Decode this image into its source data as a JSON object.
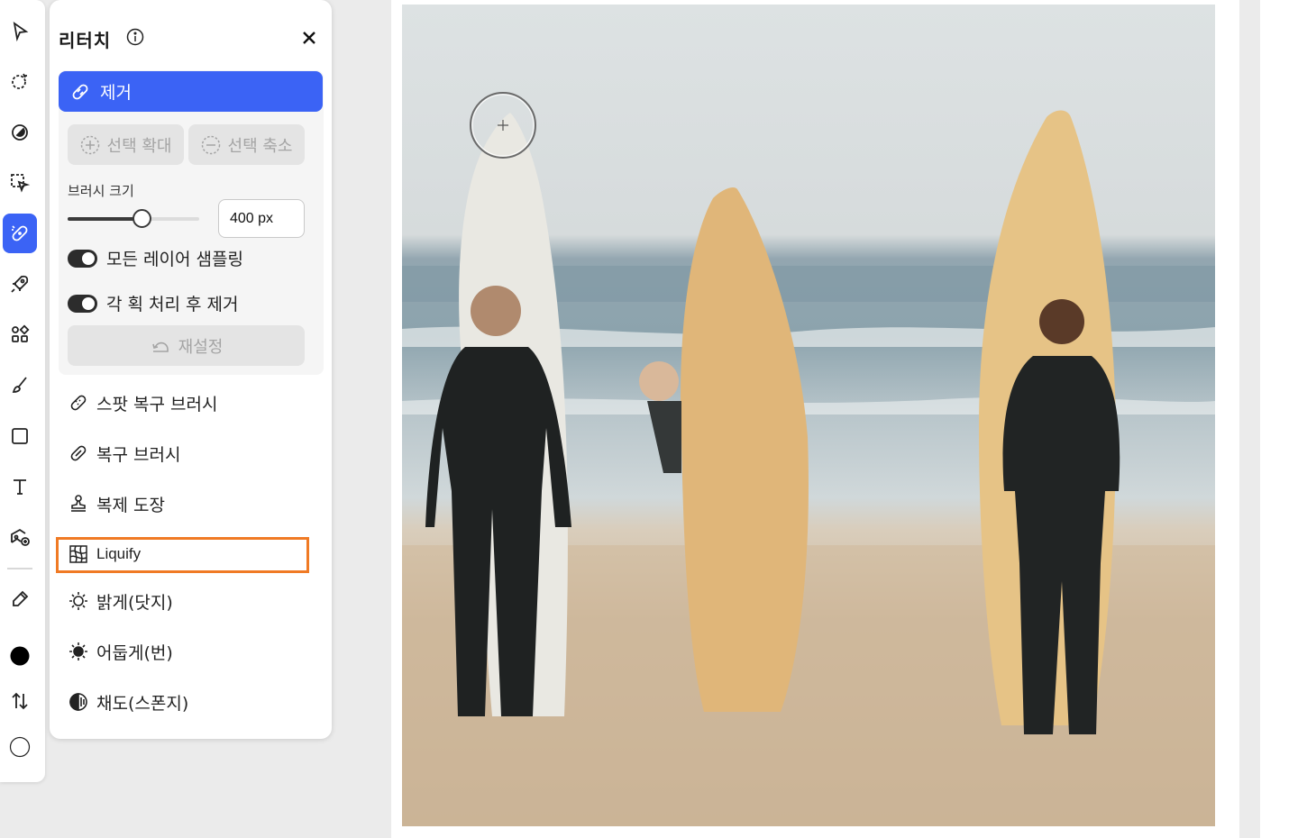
{
  "toolbar": {
    "tools": [
      "select-tool",
      "magic-select-tool",
      "adjust-tool",
      "cutout-tool",
      "retouch-tool",
      "quick-actions-tool",
      "layout-tool",
      "brush-tool",
      "shape-tool",
      "text-tool",
      "add-image-tool",
      "eyedropper-tool"
    ],
    "active_tool": "retouch-tool",
    "foreground_color": "#000000",
    "background_color": "#ffffff"
  },
  "panel": {
    "title": "리터치",
    "remove_label": "제거",
    "expand_selection_label": "선택 확대",
    "shrink_selection_label": "선택 축소",
    "brush_size_label": "브러시 크기",
    "brush_size_value": "400 px",
    "brush_size_fraction": 0.56,
    "sample_all_layers_label": "모든 레이어 샘플링",
    "sample_all_layers_on": true,
    "remove_after_stroke_label": "각 획 처리 후 제거",
    "remove_after_stroke_on": true,
    "reset_label": "재설정",
    "tools": {
      "spot_healing": "스팟 복구 브러시",
      "healing": "복구 브러시",
      "clone_stamp": "복제 도장",
      "liquify": "Liquify",
      "dodge": "밝게(닷지)",
      "burn": "어둡게(번)",
      "sponge": "채도(스폰지)"
    }
  },
  "colors": {
    "accent": "#3b63f5",
    "highlight": "#f07a24"
  }
}
